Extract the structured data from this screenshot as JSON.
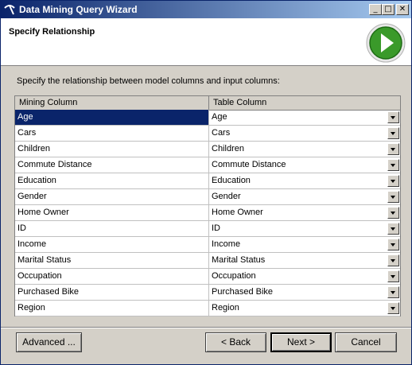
{
  "window": {
    "title": "Data Mining Query Wizard",
    "controls": {
      "minimize": "_",
      "maximize": "□",
      "close": "✕"
    }
  },
  "header": {
    "title": "Specify Relationship",
    "badge_icon": "green-next-arrow-icon"
  },
  "instruction": "Specify the relationship between model columns and input columns:",
  "grid": {
    "columns": [
      "Mining Column",
      "Table Column"
    ],
    "selected_row": 0,
    "rows": [
      {
        "mining": "Age",
        "table": "Age"
      },
      {
        "mining": "Cars",
        "table": "Cars"
      },
      {
        "mining": "Children",
        "table": "Children"
      },
      {
        "mining": "Commute Distance",
        "table": "Commute Distance"
      },
      {
        "mining": "Education",
        "table": "Education"
      },
      {
        "mining": "Gender",
        "table": "Gender"
      },
      {
        "mining": "Home Owner",
        "table": "Home Owner"
      },
      {
        "mining": "ID",
        "table": "ID"
      },
      {
        "mining": "Income",
        "table": "Income"
      },
      {
        "mining": "Marital Status",
        "table": "Marital Status"
      },
      {
        "mining": "Occupation",
        "table": "Occupation"
      },
      {
        "mining": "Purchased Bike",
        "table": "Purchased Bike"
      },
      {
        "mining": "Region",
        "table": "Region"
      }
    ]
  },
  "buttons": {
    "advanced": "Advanced ...",
    "back": "< Back",
    "next": "Next >",
    "cancel": "Cancel"
  },
  "colors": {
    "title_bar_start": "#0a246a",
    "title_bar_end": "#a6caf0",
    "selection": "#0a246a",
    "badge_green": "#3a9a2a"
  }
}
